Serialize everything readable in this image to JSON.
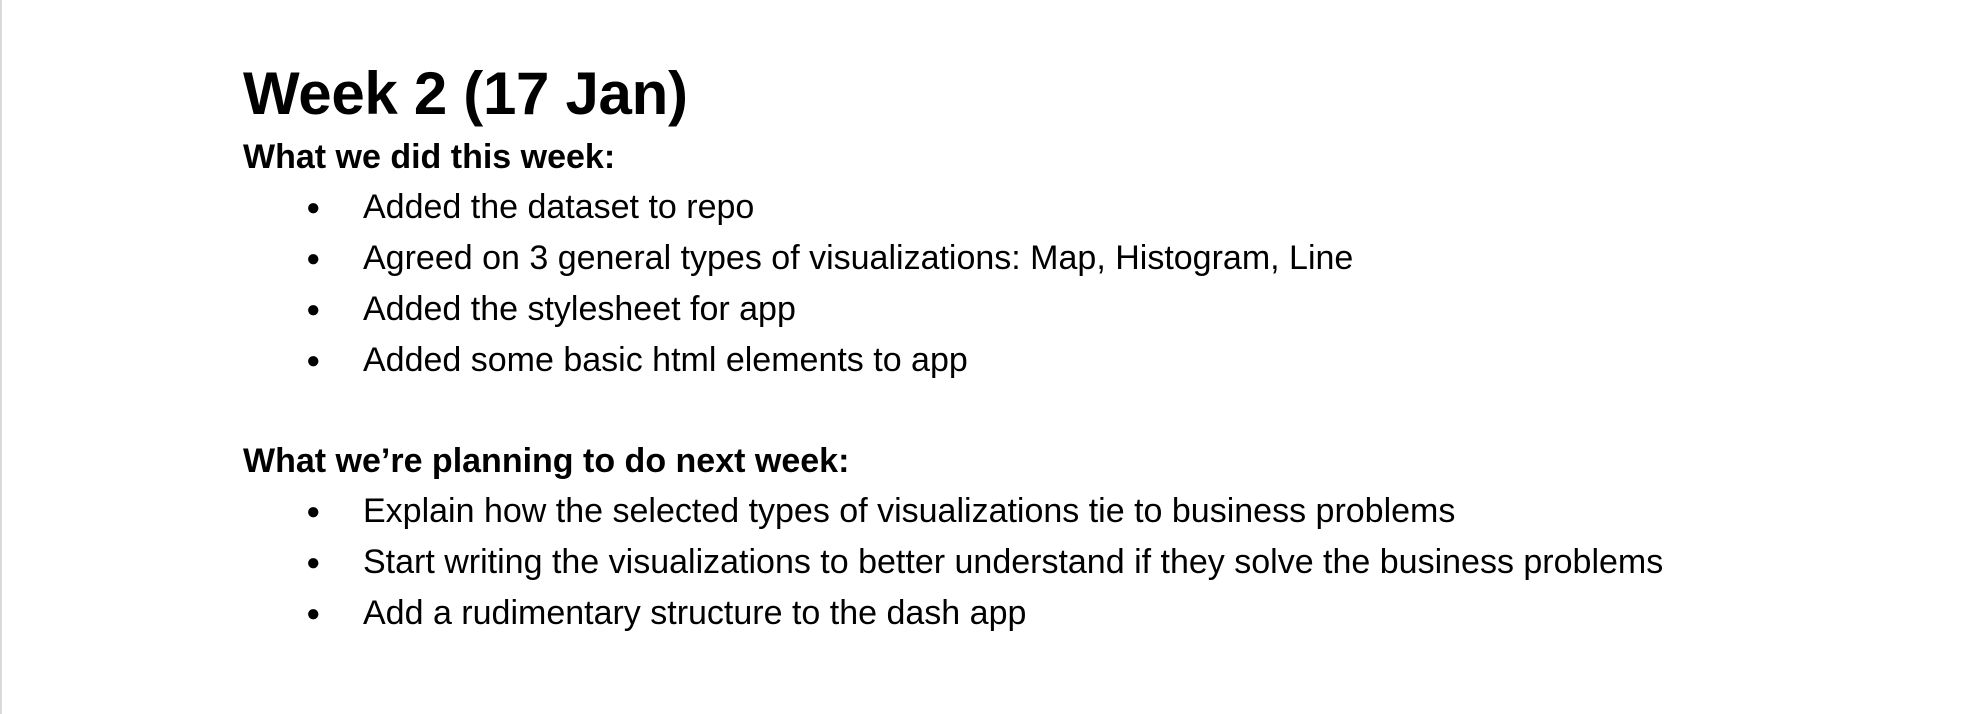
{
  "document": {
    "title": "Week 2 (17 Jan)",
    "sections": [
      {
        "heading": "What we did this week:",
        "items": [
          "Added the dataset to repo",
          "Agreed on 3 general types of visualizations: Map, Histogram, Line",
          "Added the stylesheet for app",
          "Added some basic html elements to app"
        ]
      },
      {
        "heading": "What we’re planning to do next week:",
        "items": [
          "Explain how the selected types of visualizations tie to business problems",
          "Start writing the visualizations to better understand if they solve the business problems",
          "Add a rudimentary structure to the dash app"
        ]
      }
    ],
    "bullet_glyph": "●"
  }
}
